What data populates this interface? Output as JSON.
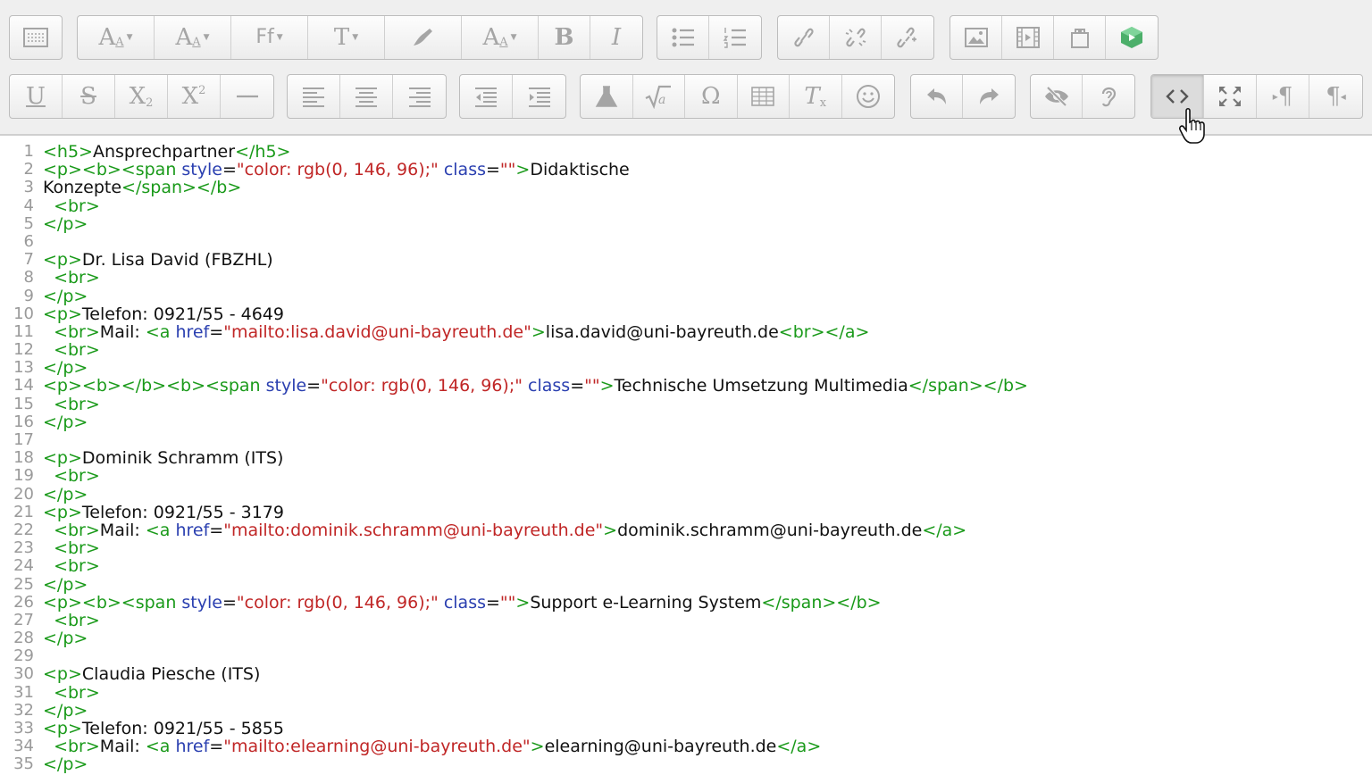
{
  "toolbar": {
    "row1": [
      {
        "name": "toolbar-toggle-button",
        "icon": "kitchen-sink-icon"
      },
      {
        "name": "style-button",
        "icon": "paragraph-style-icon",
        "label": "A"
      },
      {
        "name": "font-color-button",
        "icon": "font-size-icon",
        "label": "A"
      },
      {
        "name": "font-family-button",
        "icon": "font-family-icon",
        "label": "Ff"
      },
      {
        "name": "font-size-button",
        "icon": "text-size-icon",
        "label": "T"
      },
      {
        "name": "highlight-button",
        "icon": "brush-icon"
      },
      {
        "name": "text-style-button",
        "icon": "text-format-icon",
        "label": "A"
      },
      {
        "name": "bold-button",
        "icon": "bold-icon",
        "label": "B"
      },
      {
        "name": "italic-button",
        "icon": "italic-icon",
        "label": "I"
      },
      {
        "name": "unordered-list-button",
        "icon": "bullet-list-icon"
      },
      {
        "name": "ordered-list-button",
        "icon": "number-list-icon"
      },
      {
        "name": "link-button",
        "icon": "link-icon"
      },
      {
        "name": "unlink-button",
        "icon": "unlink-icon"
      },
      {
        "name": "auto-link-button",
        "icon": "chain-icon"
      },
      {
        "name": "image-button",
        "icon": "image-icon"
      },
      {
        "name": "media-button",
        "icon": "film-icon"
      },
      {
        "name": "manage-files-button",
        "icon": "files-icon"
      },
      {
        "name": "h5p-button",
        "icon": "h5p-icon"
      }
    ],
    "row2": [
      {
        "name": "underline-button",
        "icon": "underline-icon",
        "label": "U"
      },
      {
        "name": "strikethrough-button",
        "icon": "strikethrough-icon",
        "label": "S"
      },
      {
        "name": "subscript-button",
        "icon": "subscript-icon",
        "label": "X"
      },
      {
        "name": "superscript-button",
        "icon": "superscript-icon",
        "label": "X"
      },
      {
        "name": "horizontal-rule-button",
        "icon": "hr-icon"
      },
      {
        "name": "align-left-button",
        "icon": "align-left-icon"
      },
      {
        "name": "align-center-button",
        "icon": "align-center-icon"
      },
      {
        "name": "align-right-button",
        "icon": "align-right-icon"
      },
      {
        "name": "outdent-button",
        "icon": "outdent-icon"
      },
      {
        "name": "indent-button",
        "icon": "indent-icon"
      },
      {
        "name": "chemistry-button",
        "icon": "flask-icon"
      },
      {
        "name": "equation-button",
        "icon": "sqrt-icon"
      },
      {
        "name": "special-char-button",
        "icon": "omega-icon",
        "label": "Ω"
      },
      {
        "name": "table-button",
        "icon": "table-icon"
      },
      {
        "name": "clear-formatting-button",
        "icon": "clear-format-icon",
        "label": "T"
      },
      {
        "name": "emoticon-button",
        "icon": "smiley-icon"
      },
      {
        "name": "undo-button",
        "icon": "undo-icon"
      },
      {
        "name": "redo-button",
        "icon": "redo-icon"
      },
      {
        "name": "accessibility-checker-button",
        "icon": "eye-slash-icon"
      },
      {
        "name": "screenreader-helper-button",
        "icon": "ear-icon"
      },
      {
        "name": "html-source-button",
        "icon": "code-icon",
        "active": true
      },
      {
        "name": "fullscreen-button",
        "icon": "expand-icon"
      },
      {
        "name": "ltr-button",
        "icon": "pilcrow-ltr-icon",
        "label": "¶"
      },
      {
        "name": "rtl-button",
        "icon": "pilcrow-rtl-icon",
        "label": "¶"
      }
    ]
  },
  "editor": {
    "line_numbers": [
      "1",
      "2",
      "3",
      "4",
      "5",
      "6",
      "7",
      "8",
      "9",
      "10",
      "11",
      "12",
      "13",
      "14",
      "15",
      "16",
      "17",
      "18",
      "19",
      "20",
      "21",
      "22",
      "23",
      "24",
      "25",
      "26",
      "27",
      "28",
      "29",
      "30",
      "31",
      "32",
      "33",
      "34",
      "35"
    ],
    "lines": [
      [
        [
          "tag",
          "<h5>"
        ],
        [
          "txt",
          "Ansprechpartner"
        ],
        [
          "tag",
          "</h5>"
        ]
      ],
      [
        [
          "tag",
          "<p><b><span "
        ],
        [
          "attr",
          "style"
        ],
        [
          "txt",
          "="
        ],
        [
          "str",
          "\"color: rgb(0, 146, 96);\""
        ],
        [
          "txt",
          " "
        ],
        [
          "attr",
          "class"
        ],
        [
          "txt",
          "="
        ],
        [
          "str",
          "\"\""
        ],
        [
          "tag",
          ">"
        ],
        [
          "txt",
          "Didaktische"
        ]
      ],
      [
        [
          "txt",
          "Konzepte"
        ],
        [
          "tag",
          "</span></b>"
        ]
      ],
      [
        [
          "tag",
          "  <br>"
        ]
      ],
      [
        [
          "tag",
          "</p>"
        ]
      ],
      [],
      [
        [
          "tag",
          "<p>"
        ],
        [
          "txt",
          "Dr. Lisa David (FBZHL)"
        ]
      ],
      [
        [
          "tag",
          "  <br>"
        ]
      ],
      [
        [
          "tag",
          "</p>"
        ]
      ],
      [
        [
          "tag",
          "<p>"
        ],
        [
          "txt",
          "Telefon: 0921/55 - 4649"
        ]
      ],
      [
        [
          "tag",
          "  <br>"
        ],
        [
          "txt",
          "Mail: "
        ],
        [
          "tag",
          "<a "
        ],
        [
          "attr",
          "href"
        ],
        [
          "txt",
          "="
        ],
        [
          "str",
          "\"mailto:lisa.david@uni-bayreuth.de\""
        ],
        [
          "tag",
          ">"
        ],
        [
          "txt",
          "lisa.david@uni-bayreuth.de"
        ],
        [
          "tag",
          "<br></a>"
        ]
      ],
      [
        [
          "tag",
          "  <br>"
        ]
      ],
      [
        [
          "tag",
          "</p>"
        ]
      ],
      [
        [
          "tag",
          "<p><b></b><b><span "
        ],
        [
          "attr",
          "style"
        ],
        [
          "txt",
          "="
        ],
        [
          "str",
          "\"color: rgb(0, 146, 96);\""
        ],
        [
          "txt",
          " "
        ],
        [
          "attr",
          "class"
        ],
        [
          "txt",
          "="
        ],
        [
          "str",
          "\"\""
        ],
        [
          "tag",
          ">"
        ],
        [
          "txt",
          "Technische Umsetzung Multimedia"
        ],
        [
          "tag",
          "</span></b>"
        ]
      ],
      [
        [
          "tag",
          "  <br>"
        ]
      ],
      [
        [
          "tag",
          "</p>"
        ]
      ],
      [],
      [
        [
          "tag",
          "<p>"
        ],
        [
          "txt",
          "Dominik Schramm (ITS)"
        ]
      ],
      [
        [
          "tag",
          "  <br>"
        ]
      ],
      [
        [
          "tag",
          "</p>"
        ]
      ],
      [
        [
          "tag",
          "<p>"
        ],
        [
          "txt",
          "Telefon: 0921/55 - 3179"
        ]
      ],
      [
        [
          "tag",
          "  <br>"
        ],
        [
          "txt",
          "Mail: "
        ],
        [
          "tag",
          "<a "
        ],
        [
          "attr",
          "href"
        ],
        [
          "txt",
          "="
        ],
        [
          "str",
          "\"mailto:dominik.schramm@uni-bayreuth.de\""
        ],
        [
          "tag",
          ">"
        ],
        [
          "txt",
          "dominik.schramm@uni-bayreuth.de"
        ],
        [
          "tag",
          "</a>"
        ]
      ],
      [
        [
          "tag",
          "  <br>"
        ]
      ],
      [
        [
          "tag",
          "  <br>"
        ]
      ],
      [
        [
          "tag",
          "</p>"
        ]
      ],
      [
        [
          "tag",
          "<p><b><span "
        ],
        [
          "attr",
          "style"
        ],
        [
          "txt",
          "="
        ],
        [
          "str",
          "\"color: rgb(0, 146, 96);\""
        ],
        [
          "txt",
          " "
        ],
        [
          "attr",
          "class"
        ],
        [
          "txt",
          "="
        ],
        [
          "str",
          "\"\""
        ],
        [
          "tag",
          ">"
        ],
        [
          "txt",
          "Support e-Learning System"
        ],
        [
          "tag",
          "</span></b>"
        ]
      ],
      [
        [
          "tag",
          "  <br>"
        ]
      ],
      [
        [
          "tag",
          "</p>"
        ]
      ],
      [],
      [
        [
          "tag",
          "<p>"
        ],
        [
          "txt",
          "Claudia Piesche (ITS)"
        ]
      ],
      [
        [
          "tag",
          "  <br>"
        ]
      ],
      [
        [
          "tag",
          "</p>"
        ]
      ],
      [
        [
          "tag",
          "<p>"
        ],
        [
          "txt",
          "Telefon: 0921/55 - 5855"
        ]
      ],
      [
        [
          "tag",
          "  <br>"
        ],
        [
          "txt",
          "Mail: "
        ],
        [
          "tag",
          "<a "
        ],
        [
          "attr",
          "href"
        ],
        [
          "txt",
          "="
        ],
        [
          "str",
          "\"mailto:elearning@uni-bayreuth.de\""
        ],
        [
          "tag",
          ">"
        ],
        [
          "txt",
          "elearning@uni-bayreuth.de"
        ],
        [
          "tag",
          "</a>"
        ]
      ],
      [
        [
          "tag",
          "</p>"
        ]
      ]
    ]
  }
}
